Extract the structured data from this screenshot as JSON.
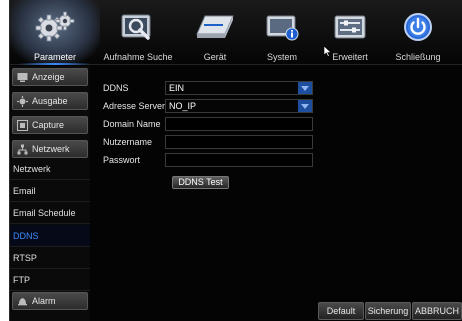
{
  "top_menu": {
    "tabs": [
      {
        "label": "Parameter",
        "icon": "gears-icon",
        "active": true
      },
      {
        "label": "Aufnahme Suche",
        "icon": "magnifier-icon",
        "active": false
      },
      {
        "label": "Gerät",
        "icon": "hard-drive-icon",
        "active": false
      },
      {
        "label": "System",
        "icon": "system-info-icon",
        "active": false
      },
      {
        "label": "Erweitert",
        "icon": "advanced-settings-icon",
        "active": false
      },
      {
        "label": "Schließung",
        "icon": "power-icon",
        "active": false
      }
    ]
  },
  "sidebar": {
    "categories": [
      {
        "label": "Anzeige",
        "icon": "monitor-icon"
      },
      {
        "label": "Ausgabe",
        "icon": "output-icon"
      },
      {
        "label": "Capture",
        "icon": "capture-icon"
      },
      {
        "label": "Netzwerk",
        "icon": "network-icon"
      },
      {
        "label": "Alarm",
        "icon": "alarm-icon"
      }
    ],
    "items": [
      {
        "label": "Netzwerk",
        "active": false
      },
      {
        "label": "Email",
        "active": false
      },
      {
        "label": "Email Schedule",
        "active": false
      },
      {
        "label": "DDNS",
        "active": true
      },
      {
        "label": "RTSP",
        "active": false
      },
      {
        "label": "FTP",
        "active": false
      }
    ]
  },
  "form": {
    "ddns": {
      "label": "DDNS",
      "value": "EIN"
    },
    "server": {
      "label": "Adresse Server",
      "value": "NO_IP"
    },
    "domain": {
      "label": "Domain Name",
      "value": ""
    },
    "username": {
      "label": "Nutzername",
      "value": ""
    },
    "password": {
      "label": "Passwort",
      "value": ""
    },
    "test_button": "DDNS Test"
  },
  "footer": {
    "default_label": "Default",
    "save_label": "Sicherung",
    "cancel_label": "ABBRUCH"
  },
  "colors": {
    "accent": "#3d8cff",
    "background": "#040404",
    "dropdown": "#1e4f9e"
  }
}
